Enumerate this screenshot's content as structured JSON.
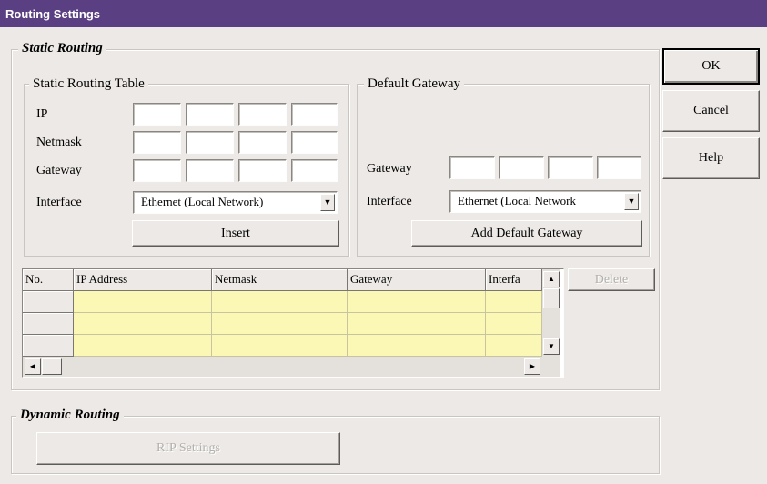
{
  "window": {
    "title": "Routing Settings"
  },
  "static_routing": {
    "group_label": "Static Routing",
    "table_section": {
      "label": "Static Routing Table",
      "ip_label": "IP",
      "netmask_label": "Netmask",
      "gateway_label": "Gateway",
      "interface_label": "Interface",
      "interface_value": "Ethernet (Local Network)",
      "insert_button": "Insert"
    },
    "default_gateway": {
      "label": "Default Gateway",
      "gateway_label": "Gateway",
      "interface_label": "Interface",
      "interface_value": "Ethernet (Local Network",
      "add_button": "Add Default Gateway"
    },
    "routes_table": {
      "columns": [
        "No.",
        "IP Address",
        "Netmask",
        "Gateway",
        "Interfa"
      ],
      "rows": []
    },
    "delete_button": "Delete"
  },
  "dynamic_routing": {
    "group_label": "Dynamic Routing",
    "rip_button": "RIP Settings"
  },
  "buttons": {
    "ok": "OK",
    "cancel": "Cancel",
    "help": "Help"
  }
}
